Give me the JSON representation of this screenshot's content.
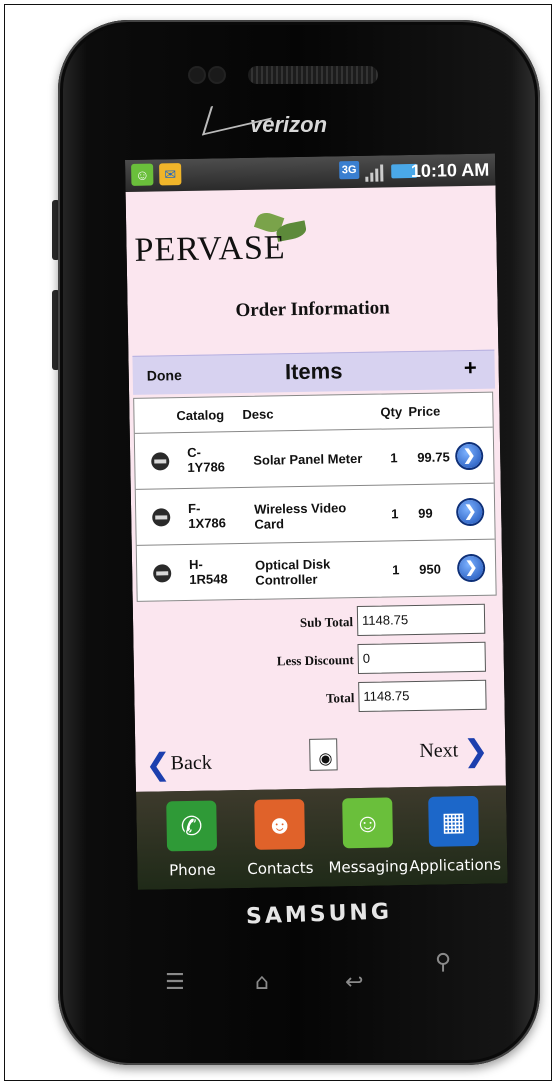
{
  "device": {
    "carrier": "verizon",
    "brand": "SAMSUNG"
  },
  "statusbar": {
    "network": "3G",
    "time": "10:10 AM",
    "icons": [
      "messaging-icon",
      "email-icon",
      "network-icon",
      "signal-icon",
      "battery-icon"
    ]
  },
  "app": {
    "logo": "PERVASE",
    "title": "Order Information",
    "items_bar": {
      "done": "Done",
      "title": "Items",
      "add": "+"
    },
    "columns": {
      "catalog": "Catalog",
      "desc": "Desc",
      "qty": "Qty",
      "price": "Price"
    },
    "rows": [
      {
        "catalog_a": "C-",
        "catalog_b": "1Y786",
        "desc_a": "Solar Panel Meter",
        "desc_b": "",
        "qty": "1",
        "price": "99.75"
      },
      {
        "catalog_a": "F-",
        "catalog_b": "1X786",
        "desc_a": "Wireless Video",
        "desc_b": "Card",
        "qty": "1",
        "price": "99"
      },
      {
        "catalog_a": "H-",
        "catalog_b": "1R548",
        "desc_a": "Optical Disk",
        "desc_b": "Controller",
        "qty": "1",
        "price": "950"
      }
    ],
    "totals": {
      "subtotal_label": "Sub Total",
      "subtotal": "1148.75",
      "discount_label": "Less Discount",
      "discount": "0",
      "total_label": "Total",
      "total": "1148.75"
    },
    "nav": {
      "back": "Back",
      "next": "Next"
    }
  },
  "dock": [
    {
      "label": "Phone",
      "icon": "phone-icon",
      "color": "#2f9a37"
    },
    {
      "label": "Contacts",
      "icon": "contacts-icon",
      "color": "#e0622a"
    },
    {
      "label": "Messaging",
      "icon": "messaging-icon",
      "color": "#6abf3b"
    },
    {
      "label": "Applications",
      "icon": "applications-icon",
      "color": "#1c67c9"
    }
  ],
  "colors": {
    "app_bg": "#fbe6ef",
    "items_bar_bg": "#d7d2f0",
    "accent_blue": "#1c3fae"
  }
}
